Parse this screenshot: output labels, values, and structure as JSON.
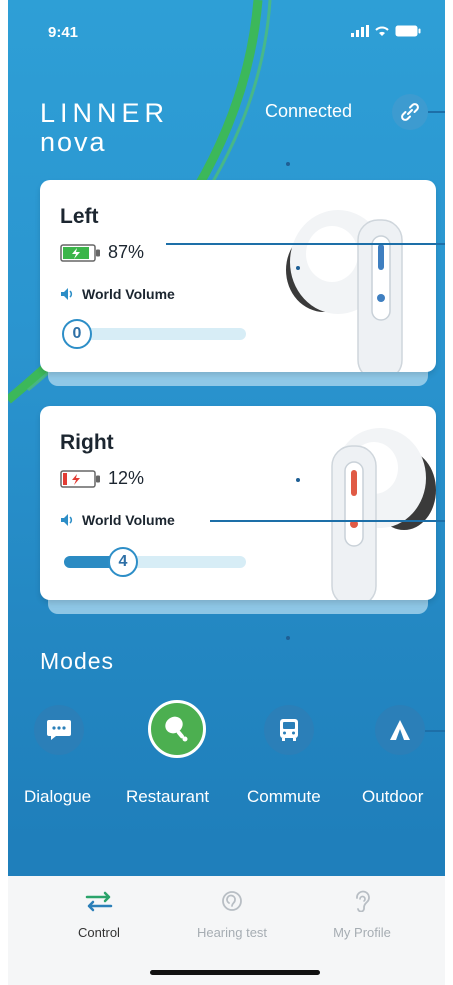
{
  "status_bar": {
    "time": "9:41"
  },
  "brand": {
    "line1": "LINNER",
    "line2": "nova"
  },
  "connection": {
    "label": "Connected",
    "icon": "link-icon"
  },
  "earbuds": {
    "left": {
      "title": "Left",
      "battery_pct": "87%",
      "battery_level": 0.87,
      "volume_label": "World Volume",
      "volume_value": "0",
      "volume_level": 0,
      "accent": "#3f7fc0"
    },
    "right": {
      "title": "Right",
      "battery_pct": "12%",
      "battery_level": 0.12,
      "volume_label": "World Volume",
      "volume_value": "4",
      "volume_level": 0.4,
      "accent": "#e05a45"
    }
  },
  "modes": {
    "title": "Modes",
    "items": [
      {
        "label": "Dialogue",
        "icon": "chat-bubble-icon",
        "active": false
      },
      {
        "label": "Restaurant",
        "icon": "drumstick-icon",
        "active": true
      },
      {
        "label": "Commute",
        "icon": "bus-icon",
        "active": false
      },
      {
        "label": "Outdoor",
        "icon": "tent-icon",
        "active": false
      }
    ]
  },
  "tabs": [
    {
      "label": "Control",
      "icon": "sliders-icon",
      "active": true
    },
    {
      "label": "Hearing test",
      "icon": "ear-scan-icon",
      "active": false
    },
    {
      "label": "My Profile",
      "icon": "ear-icon",
      "active": false
    }
  ],
  "colors": {
    "background": "#2a94cf",
    "swoosh": "#4cb85c",
    "battery_good": "#3bb54a",
    "battery_low": "#e23c34",
    "mode_active": "#4caf50",
    "mode_inactive": "#2b7fb8",
    "tab_active": "#2aa36a"
  }
}
